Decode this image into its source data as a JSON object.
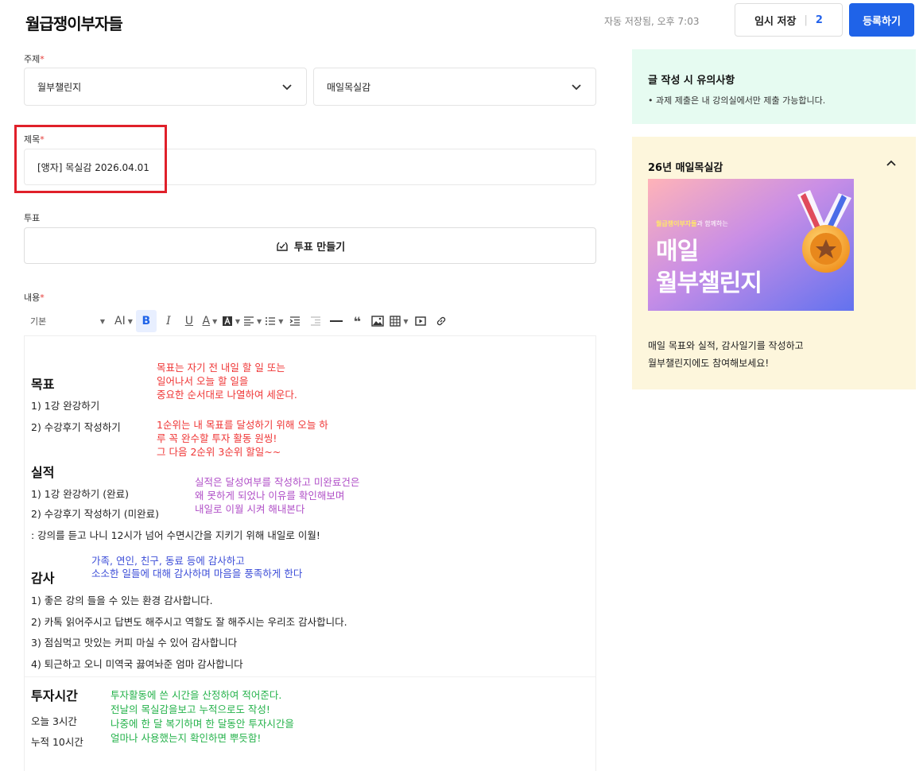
{
  "header": {
    "logo": "월급쟁이부자들",
    "autosave": "자동 저장됨, 오후 7:03",
    "temp_save_label": "임시 저장",
    "temp_save_count": "2",
    "submit_label": "등록하기"
  },
  "form": {
    "topic_label": "주제",
    "topic_select_1": "월부챌린지",
    "topic_select_2": "매일목실감",
    "title_label": "제목",
    "title_value": "[앵자] 목실감 2026.04.01",
    "poll_label": "투표",
    "poll_button": "투표 만들기",
    "content_label": "내용",
    "required_mark": "*"
  },
  "toolbar": {
    "style_select": "기본",
    "font_size": "AI",
    "bold": "B",
    "italic": "I",
    "underline": "U",
    "font_color": "A"
  },
  "editor": {
    "goal_heading": "목표",
    "goal_1": "1) 1강 완강하기",
    "goal_2": "2) 수강후기 작성하기",
    "goal_note_1": "목표는 자기 전 내일 할 일 또는",
    "goal_note_2": "일어나서 오늘 할 일을",
    "goal_note_3": "중요한 순서대로 나열하여 세운다.",
    "goal_note_4": "1순위는 내 목표를 달성하기 위해 오늘 하",
    "goal_note_5": "루 꼭 완수할 투자 활동 원씽!",
    "goal_note_6": "그 다음 2순위 3순위 할일~~",
    "result_heading": "실적",
    "result_1": "1) 1강 완강하기 (완료)",
    "result_2": "2) 수강후기 작성하기 (미완료)",
    "result_3": " : 강의를 듣고 나니 12시가 넘어 수면시간을 지키기 위해 내일로 이월!",
    "result_note_1": "실적은 달성여부를 작성하고 미완료건은",
    "result_note_2": "왜 못하게 되었나 이유를 확인해보며",
    "result_note_3": "내일로 이월 시켜 해내본다",
    "thanks_heading": "감사",
    "thanks_note_1": "가족, 연인, 친구, 동료 등에 감사하고",
    "thanks_note_2": "소소한 일들에 대해 감사하며 마음을 풍족하게 한다",
    "thanks_1": "1) 좋은 강의 들을 수 있는 환경 감사합니다.",
    "thanks_2": "2) 카톡 읽어주시고 답변도 해주시고 역할도 잘 해주시는 우리조 감사합니다.",
    "thanks_3": "3) 점심먹고 맛있는 커피 마실 수 있어 감사합니다",
    "thanks_4": "4) 퇴근하고 오니 미역국 끓여놔준 엄마 감사합니다",
    "invest_heading": "투자시간",
    "invest_today": "오늘  3시간",
    "invest_total": "누적 10시간",
    "invest_note_1": "투자활동에 쓴 시간을 산정하여 적어준다.",
    "invest_note_2": "전날의 목실감을보고 누적으로도 작성!",
    "invest_note_3": "나중에 한 달 복기하며 한 달동안 투자시간을",
    "invest_note_4": "얼마나 사용했는지 확인하면 뿌듯함!"
  },
  "sidebar": {
    "notice_title": "글 작성 시 유의사항",
    "notice_item": "과제 제출은 내 강의실에서만 제출 가능합니다.",
    "promo_title": "26년 매일목실감",
    "banner_small_brand": "월급쟁이부자들",
    "banner_small_rest": "과 함께하는",
    "banner_big_1": "매일",
    "banner_big_2": "월부챌린지",
    "promo_desc_1": "매일 목표와 실적, 감사일기를 작성하고",
    "promo_desc_2": "월부챌린지에도 참여해보세요!"
  },
  "colors": {
    "accent": "#1f63e8",
    "highlight_box": "#e0202a",
    "notice_bg": "#e6fbf1",
    "promo_bg": "#fdf6dc"
  }
}
